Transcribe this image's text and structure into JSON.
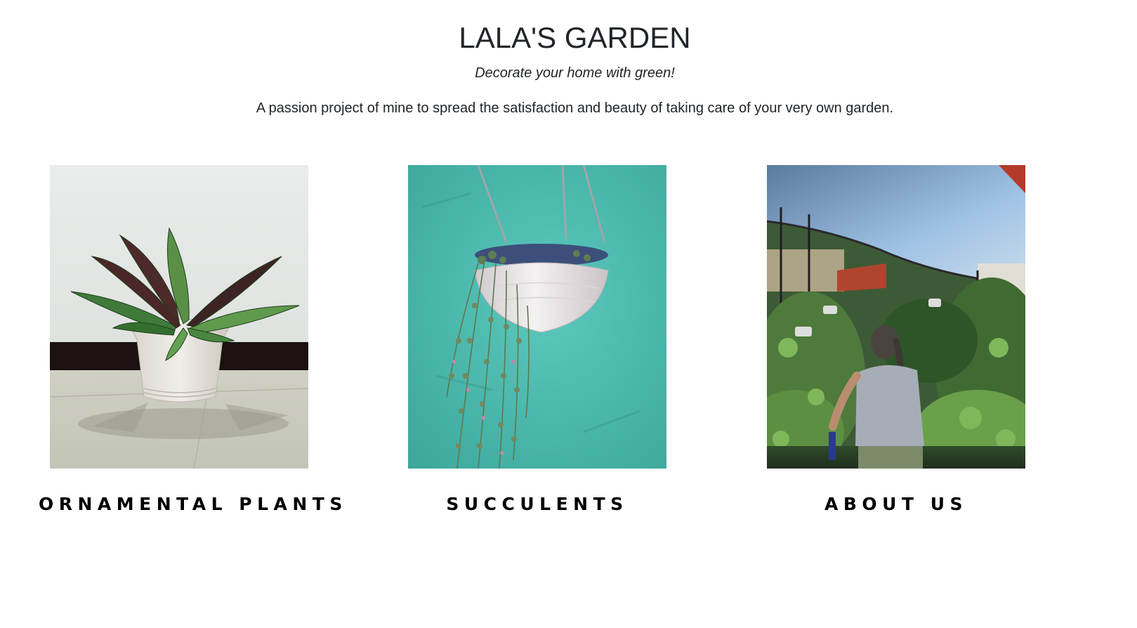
{
  "header": {
    "title": "LALA'S GARDEN",
    "tagline": "Decorate your home with green!",
    "intro": "A passion project of mine to spread the satisfaction and beauty of taking care of your very own garden."
  },
  "cards": [
    {
      "label": "ORNAMENTAL PLANTS",
      "image": "potted-calathea-plant-photo"
    },
    {
      "label": "SUCCULENTS",
      "image": "hanging-succulent-basket-photo"
    },
    {
      "label": "ABOUT US",
      "image": "garden-woman-photo"
    }
  ],
  "colors": {
    "text": "#212529",
    "label": "#000000",
    "background": "#ffffff"
  }
}
